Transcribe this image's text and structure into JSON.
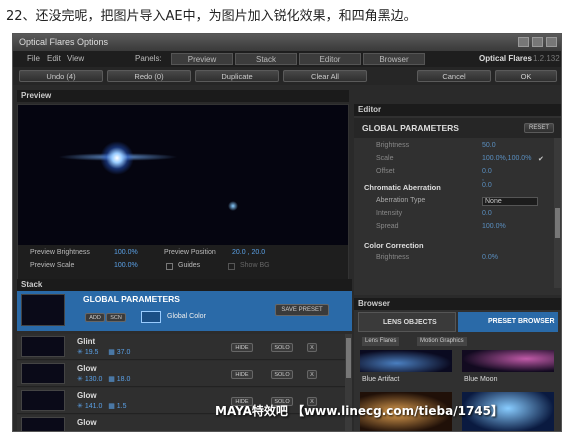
{
  "caption": "22、还没完呢，把图片导入AE中，为图片加入锐化效果，和四角黑边。",
  "window": {
    "title": "Optical Flares Options",
    "product": "Optical Flares",
    "version": "1.2.132"
  },
  "menu": {
    "file": "File",
    "edit": "Edit",
    "view": "View",
    "panels_label": "Panels:",
    "tabs": [
      "Preview",
      "Stack",
      "Editor",
      "Browser"
    ]
  },
  "toolbar": {
    "undo": "Undo (4)",
    "redo": "Redo (0)",
    "duplicate": "Duplicate",
    "clear_all": "Clear All",
    "cancel": "Cancel",
    "ok": "OK"
  },
  "preview": {
    "title": "Preview",
    "brightness_label": "Preview Brightness",
    "brightness": "100.0%",
    "scale_label": "Preview Scale",
    "scale": "100.0%",
    "position_label": "Preview Position",
    "position": "20.0 , 20.0",
    "guides": "Guides",
    "show_bg": "Show BG"
  },
  "editor": {
    "title": "Editor",
    "gp": "GLOBAL PARAMETERS",
    "reset": "RESET",
    "rows1": [
      {
        "label": "Brightness",
        "value": "50.0"
      },
      {
        "label": "Scale",
        "value": "100.0%,100.0%"
      },
      {
        "label": "Offset",
        "value": "0.0 , 0.0"
      }
    ],
    "ca_title": "Chromatic Aberration",
    "rows2": [
      {
        "label": "Aberration Type",
        "value": "None"
      },
      {
        "label": "Intensity",
        "value": "0.0"
      },
      {
        "label": "Spread",
        "value": "100.0%"
      }
    ],
    "cc_title": "Color Correction",
    "rows3": [
      {
        "label": "Brightness",
        "value": "0.0%"
      }
    ]
  },
  "stack": {
    "title": "Stack",
    "gp": "GLOBAL PARAMETERS",
    "add": "ADD",
    "scn": "SCN",
    "global_color": "Global Color",
    "save_preset": "SAVE PRESET",
    "items": [
      {
        "name": "Glint",
        "a": "19.5",
        "b": "37.0"
      },
      {
        "name": "Glow",
        "a": "130.0",
        "b": "18.0"
      },
      {
        "name": "Glow",
        "a": "141.0",
        "b": "1.5"
      },
      {
        "name": "Glow",
        "a": "",
        "b": ""
      }
    ],
    "hide": "HIDE",
    "solo": "SOLO",
    "x": "X"
  },
  "browser": {
    "title": "Browser",
    "tab1": "LENS OBJECTS",
    "tab2": "PRESET BROWSER",
    "crumb1": "Lens Flares",
    "crumb2": "Motion Graphics",
    "presets": [
      "Blue Artifact",
      "Blue Moon"
    ]
  },
  "watermark": "MAYA特效吧 【www.linecg.com/tieba/1745】"
}
